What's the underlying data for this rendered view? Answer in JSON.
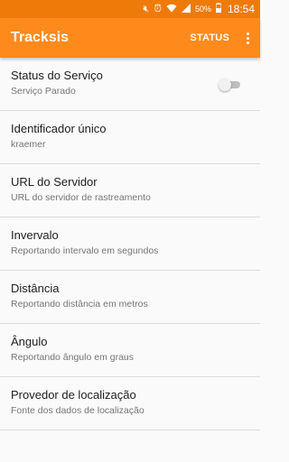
{
  "status_bar": {
    "icons": [
      "mute-icon",
      "alarm-icon",
      "wifi-icon",
      "signal-icon"
    ],
    "battery": "50%",
    "time": "18:54"
  },
  "app_bar": {
    "title": "Tracksis",
    "action_label": "STATUS",
    "accent_color": "#ff8a1c"
  },
  "settings": [
    {
      "title": "Status do Serviço",
      "summary": "Serviço Parado",
      "switch": {
        "on": false
      }
    },
    {
      "title": "Identificador único",
      "summary": "kraemer"
    },
    {
      "title": "URL do Servidor",
      "summary": "URL do servidor de rastreamento"
    },
    {
      "title": "Invervalo",
      "summary": "Reportando intervalo em segundos"
    },
    {
      "title": "Distância",
      "summary": "Reportando distância em metros"
    },
    {
      "title": "Ângulo",
      "summary": "Reportando ângulo em graus"
    },
    {
      "title": "Provedor de localização",
      "summary": "Fonte dos dados de localização"
    }
  ]
}
